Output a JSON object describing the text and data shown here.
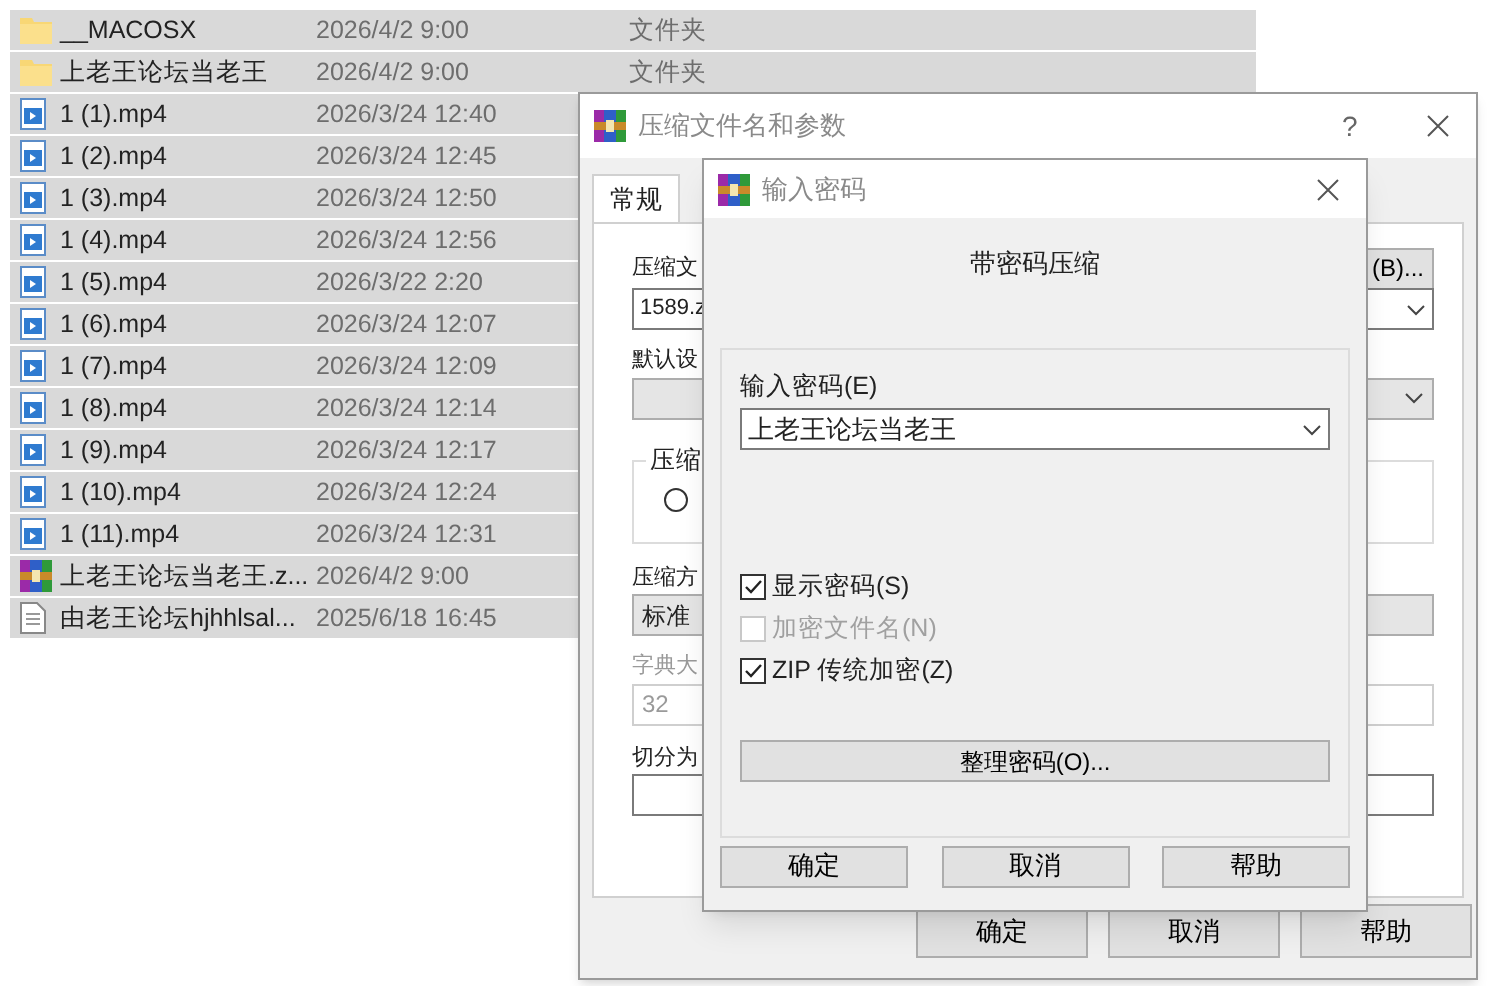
{
  "files": [
    {
      "kind": "folder",
      "name": "__MACOSX",
      "date": "2026/4/2 9:00",
      "type": "文件夹",
      "selected": true
    },
    {
      "kind": "folder",
      "name": "上老王论坛当老王",
      "date": "2026/4/2 9:00",
      "type": "文件夹",
      "selected": true
    },
    {
      "kind": "video",
      "name": "1 (1).mp4",
      "date": "2026/3/24 12:40",
      "selected": true
    },
    {
      "kind": "video",
      "name": "1 (2).mp4",
      "date": "2026/3/24 12:45",
      "selected": true
    },
    {
      "kind": "video",
      "name": "1 (3).mp4",
      "date": "2026/3/24 12:50",
      "selected": true
    },
    {
      "kind": "video",
      "name": "1 (4).mp4",
      "date": "2026/3/24 12:56",
      "selected": true
    },
    {
      "kind": "video",
      "name": "1 (5).mp4",
      "date": "2026/3/22 2:20",
      "selected": true
    },
    {
      "kind": "video",
      "name": "1 (6).mp4",
      "date": "2026/3/24 12:07",
      "selected": true
    },
    {
      "kind": "video",
      "name": "1 (7).mp4",
      "date": "2026/3/24 12:09",
      "selected": true
    },
    {
      "kind": "video",
      "name": "1 (8).mp4",
      "date": "2026/3/24 12:14",
      "selected": true
    },
    {
      "kind": "video",
      "name": "1 (9).mp4",
      "date": "2026/3/24 12:17",
      "selected": true
    },
    {
      "kind": "video",
      "name": "1 (10).mp4",
      "date": "2026/3/24 12:24",
      "selected": true
    },
    {
      "kind": "video",
      "name": "1 (11).mp4",
      "date": "2026/3/24 12:31",
      "selected": true
    },
    {
      "kind": "archive",
      "name": "上老王论坛当老王.z...",
      "date": "2026/4/2 9:00",
      "selected": true
    },
    {
      "kind": "text",
      "name": "由老王论坛hjhhlsal...",
      "date": "2025/6/18 16:45",
      "selected": true
    }
  ],
  "archive_dialog": {
    "title": "压缩文件名和参数",
    "help": "?",
    "tabs": [
      {
        "label": "常规",
        "selected": true
      }
    ],
    "archive_name_label": "压缩文",
    "archive_name_value": "1589.z",
    "browse_button": "(B)...",
    "profile_label": "默认设",
    "format_group_label": "压缩",
    "format_radio": {
      "selected": false
    },
    "method_label": "压缩方",
    "method_value": "标准",
    "dictionary_label": "字典大",
    "dictionary_value": "32",
    "split_label": "切分为",
    "buttons": [
      "确定",
      "取消",
      "帮助"
    ]
  },
  "password_dialog": {
    "title": "输入密码",
    "heading": "带密码压缩",
    "password_label": "输入密码(E)",
    "password_value": "上老王论坛当老王",
    "options": [
      {
        "label": "显示密码(S)",
        "checked": true,
        "disabled": false
      },
      {
        "label": "加密文件名(N)",
        "checked": false,
        "disabled": true
      },
      {
        "label": "ZIP 传统加密(Z)",
        "checked": true,
        "disabled": false
      }
    ],
    "manage_button": "整理密码(O)...",
    "buttons": [
      "确定",
      "取消",
      "帮助"
    ]
  }
}
